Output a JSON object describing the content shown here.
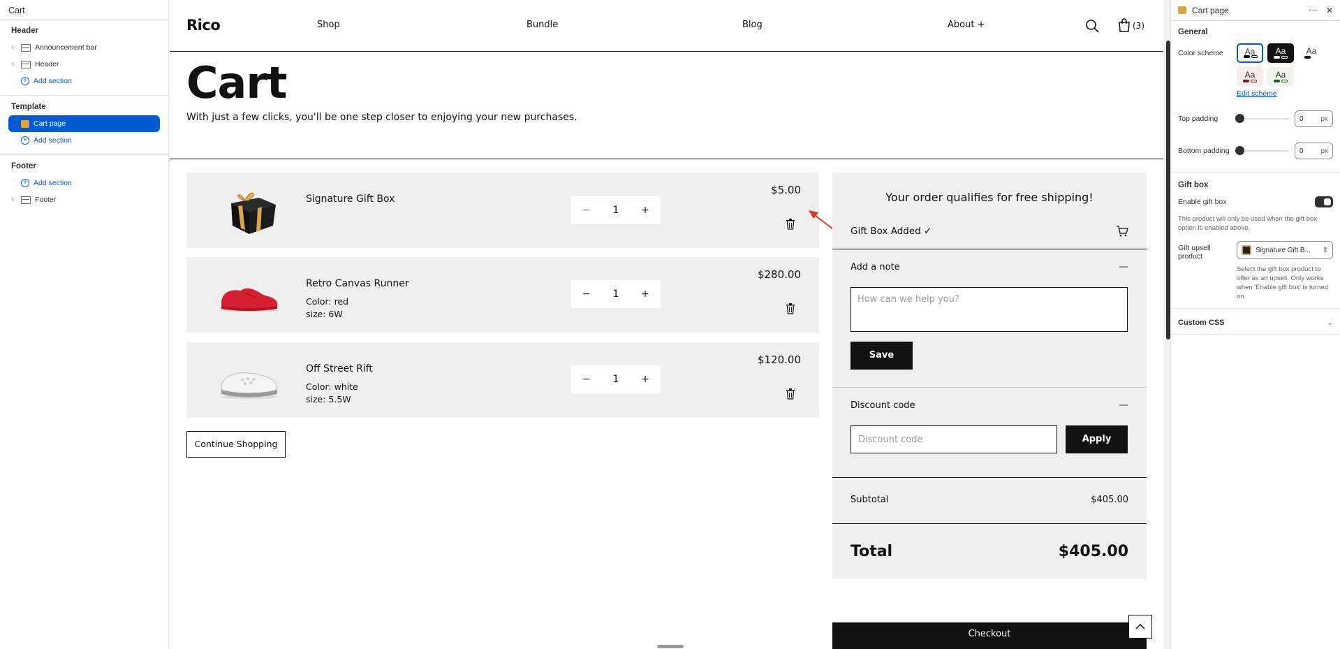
{
  "left_panel": {
    "title": "Cart",
    "header_group": {
      "title": "Header",
      "items": [
        "Announcement bar",
        "Header"
      ],
      "add": "Add section"
    },
    "template_group": {
      "title": "Template",
      "selected": "Cart page",
      "add": "Add section"
    },
    "footer_group": {
      "title": "Footer",
      "add": "Add section",
      "items": [
        "Footer"
      ]
    }
  },
  "right_panel": {
    "title": "Cart page",
    "more": "⋯",
    "close": "✕",
    "general": "General",
    "color_scheme_label": "Color scheme",
    "swatch_text": "Aa",
    "edit_scheme": "Edit scheme",
    "top_padding_label": "Top padding",
    "top_padding_value": "0",
    "bottom_padding_label": "Bottom padding",
    "bottom_padding_value": "0",
    "unit": "px",
    "gift_box_title": "Gift box",
    "enable_gift_box": "Enable gift box",
    "gift_help": "This product will only be used when the gift box option is enabled above.",
    "gift_upsell_label": "Gift upsell product",
    "gift_upsell_value": "Signature Gift B...",
    "upsell_help": "Select the gift box product to offer as an upsell. Only works when 'Enable gift box' is turned on.",
    "custom_css": "Custom CSS"
  },
  "site": {
    "logo": "Rico",
    "nav": [
      "Shop",
      "Bundle",
      "Blog",
      "About +"
    ],
    "cart_count": "(3)",
    "heading": "Cart",
    "subheading": "With just a few clicks, you'll be one step closer to enjoying your new purchases.",
    "items": [
      {
        "name": "Signature Gift Box",
        "meta1": "",
        "meta2": "",
        "qty": "1",
        "price": "$5.00"
      },
      {
        "name": "Retro Canvas Runner",
        "meta1": "Color: red",
        "meta2": "size: 6W",
        "qty": "1",
        "price": "$280.00"
      },
      {
        "name": "Off Street Rift",
        "meta1": "Color: white",
        "meta2": "size: 5.5W",
        "qty": "1",
        "price": "$120.00"
      }
    ],
    "continue": "Continue Shopping",
    "summary": {
      "shipping": "Your order qualifies for free shipping!",
      "gift_added": "Gift Box Added ✓",
      "note_label": "Add a note",
      "note_placeholder": "How can we help you?",
      "save": "Save",
      "discount_label": "Discount code",
      "discount_placeholder": "Discount code",
      "apply": "Apply",
      "subtotal_label": "Subtotal",
      "subtotal_value": "$405.00",
      "total_label": "Total",
      "total_value": "$405.00",
      "collapse": "—"
    },
    "checkout": "Checkout"
  }
}
